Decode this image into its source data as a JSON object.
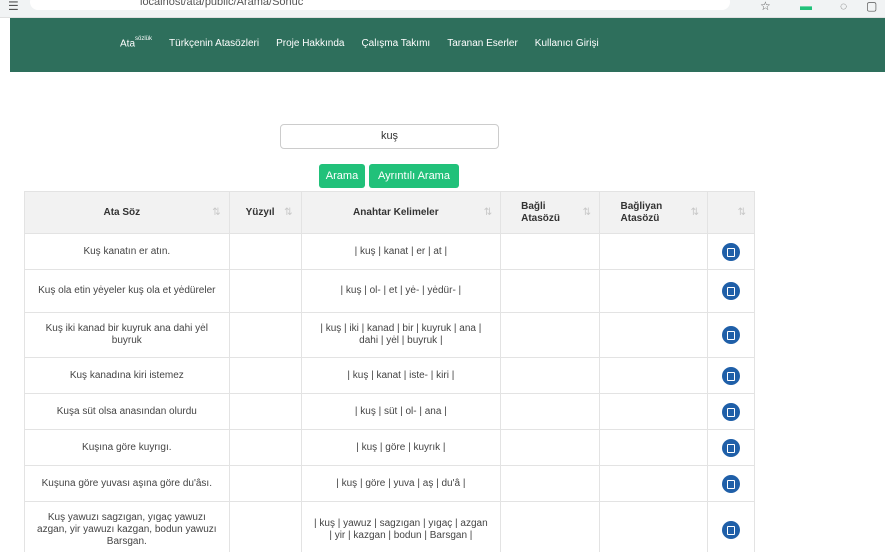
{
  "browser": {
    "url": "localhost/ata/public/Arama/Sonuc"
  },
  "nav": {
    "brand": "Ata",
    "brand_sup": "sözlük",
    "items": [
      "Türkçenin Atasözleri",
      "Proje Hakkında",
      "Çalışma Takımı",
      "Taranan Eserler",
      "Kullanıcı Girişi"
    ]
  },
  "search": {
    "value": "kuş",
    "button_search": "Arama",
    "button_detailed": "Ayrıntılı Arama"
  },
  "table": {
    "headers": [
      "Ata Söz",
      "Yüzyıl",
      "Anahtar Kelimeler",
      "Bağli Atasözü",
      "Bağliyan Atasözü",
      ""
    ],
    "sort_icon": "⇅",
    "rows": [
      {
        "soz": "Kuş kanatın er atın.",
        "yuzyil": "",
        "kelimeler": "| kuş | kanat | er | at |"
      },
      {
        "soz": "Kuş ola etin yėyeler kuş ola et yėdüreler",
        "yuzyil": "",
        "kelimeler": "| kuş | ol- | et | yė- | yėdür- |"
      },
      {
        "soz": "Kuş iki kanad bir kuyruk ana dahi yėl buyruk",
        "yuzyil": "",
        "kelimeler": "| kuş | iki | kanad | bir | kuyruk | ana | dahi | yėl | buyruk |"
      },
      {
        "soz": "Kuş kanadına kiri istemez",
        "yuzyil": "",
        "kelimeler": "| kuş | kanat | iste- | kiri |"
      },
      {
        "soz": "Kuşa süt olsa anasından olurdu",
        "yuzyil": "",
        "kelimeler": "| kuş | süt | ol- | ana |"
      },
      {
        "soz": "Kuşına göre kuyrıgı.",
        "yuzyil": "",
        "kelimeler": "| kuş | göre | kuyrık |"
      },
      {
        "soz": "Kuşuna göre yuvası aşına göre du'âsı.",
        "yuzyil": "",
        "kelimeler": "| kuş | göre | yuva | aş | du'â |"
      },
      {
        "soz": "Kuş yawuzı sagzıgan, yıgaç yawuzı azgan, yir yawuzı kazgan, bodun yawuzı Barsgan.",
        "yuzyil": "",
        "kelimeler": "| kuş | yawuz | sagzıgan | yıgaç | azgan | yir | kazgan | bodun | Barsgan |"
      }
    ]
  },
  "colors": {
    "navbar": "#2e6f5c",
    "button": "#21c17a",
    "edit_icon": "#1f5fa8"
  }
}
